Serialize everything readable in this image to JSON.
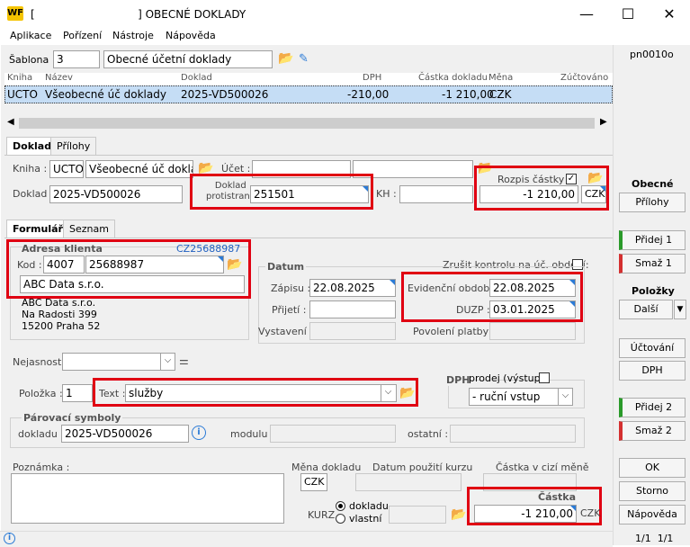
{
  "window": {
    "title": "[                              ] OBECNÉ DOKLADY",
    "logo": "WF",
    "minimize": "—",
    "maximize": "☐",
    "close": "✕"
  },
  "menu": [
    "Aplikace",
    "Pořízení",
    "Nástroje",
    "Nápověda"
  ],
  "form_id": "pn0010o",
  "sablona": {
    "label": "Šablona :",
    "code": "3",
    "name": "Obecné účetní doklady"
  },
  "grid": {
    "headers": [
      "Kniha",
      "Název",
      "Doklad",
      "DPH",
      "Částka dokladu",
      "Měna",
      "Zúčtováno"
    ],
    "row": [
      "UCTO",
      "Všeobecné úč doklady",
      "2025-VD500026",
      "-210,00",
      "-1 210,00",
      "CZK",
      ""
    ]
  },
  "tabs_top": [
    "Doklad",
    "Přílohy"
  ],
  "doklad": {
    "kniha_label": "Kniha :",
    "kniha_code": "UCTO",
    "kniha_name": "Všeobecné úč doklad",
    "ucet_label": "Účet :",
    "doklad_label": "Doklad :",
    "doklad_value": "2025-VD500026",
    "protistrany_label1": "Doklad",
    "protistrany_label2": "protistrany",
    "protistrany_value": "251501",
    "kh_label": "KH :",
    "rozpis_label": "Rozpis částky :",
    "castka": "-1 210,00",
    "mena": "CZK"
  },
  "tabs_inner": [
    "Formulář",
    "Seznam"
  ],
  "adresa": {
    "title": "Adresa klienta",
    "cz": "CZ25688987",
    "kod_label": "Kod :",
    "kod1": "4007",
    "kod2": "25688987",
    "name": "ABC Data s.r.o.",
    "lines": [
      "ABC Data s.r.o.",
      "Na Radosti 399",
      "15200 Praha 52"
    ]
  },
  "zrusit": "Zrušit kontrolu na úč. období:",
  "datum": {
    "title": "Datum",
    "zapisu_label": "Zápisu :",
    "zapisu": "22.08.2025",
    "prijeti_label": "Přijetí :",
    "vystaveni_label": "Vystavení :",
    "evid_label": "Evidenční období :",
    "evid": "22.08.2025",
    "duzp_label": "DUZP :",
    "duzp": "03.01.2025",
    "povoleni_label": "Povolení platby :"
  },
  "nejasnost_label": "Nejasnost :",
  "polozka": {
    "label": "Položka :",
    "value": "1",
    "text_label": "Text :",
    "text": "služby"
  },
  "dph": {
    "label": "DPH",
    "prodej": "prodej (výstup)",
    "select": "- ruční vstup"
  },
  "parovaci": {
    "title": "Párovací symboly",
    "dokladu_label": "dokladu :",
    "dokladu": "2025-VD500026",
    "modulu_label": "modulu :",
    "ostatni_label": "ostatní :"
  },
  "poznamka_label": "Poznámka :",
  "bottom": {
    "mena_label": "Měna dokladu",
    "mena": "CZK",
    "datum_kurzu": "Datum použití kurzu",
    "castka_cizi": "Částka v cizí měně",
    "kurz": "KURZ",
    "dokladu": "dokladu",
    "vlastni": "vlastní",
    "castka_label": "Částka",
    "castka": "-1 210,00",
    "castka_mena": "CZK"
  },
  "right": {
    "obecne": "Obecné",
    "prilohy": "Přílohy",
    "pridej1": "Přidej 1",
    "smaz1": "Smaž 1",
    "polozky": "Položky",
    "dalsi": "Další",
    "uctovani": "Účtování",
    "dph": "DPH",
    "pridej2": "Přidej 2",
    "smaz2": "Smaž 2",
    "ok": "OK",
    "storno": "Storno",
    "napoveda": "Nápověda",
    "page": "1/1  1/1"
  }
}
